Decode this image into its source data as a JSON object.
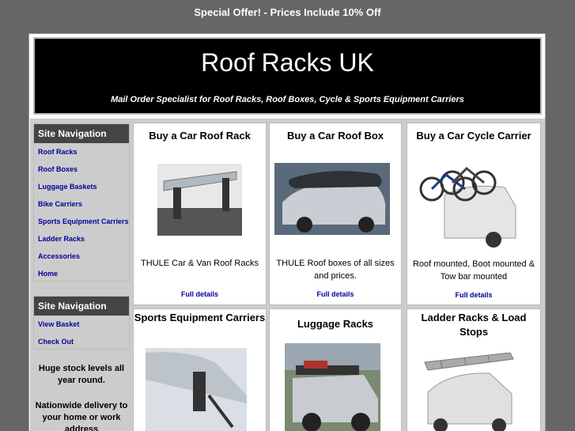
{
  "header": {
    "offer": "Special Offer! - Prices Include 10% Off",
    "title": "Roof Racks UK",
    "subtitle": "Mail Order Specialist for Roof Racks, Roof Boxes, Cycle & Sports Equipment Carriers"
  },
  "nav1": {
    "heading": "Site Navigation",
    "items": [
      "Roof Racks",
      "Roof Boxes",
      "Luggage Baskets",
      "Bike Carriers",
      "Sports Equipment Carriers",
      "Ladder Racks",
      "Accessories",
      "Home"
    ]
  },
  "nav2": {
    "heading": "Site Navigation",
    "items": [
      "View Basket",
      "Check Out"
    ]
  },
  "sidebar": {
    "stock": "Huge stock levels all year round.",
    "delivery": "Nationwide delivery to your home or work address"
  },
  "cards": [
    {
      "title": "Buy a Car Roof Rack",
      "desc": "THULE Car & Van Roof Racks",
      "link": "Full details"
    },
    {
      "title": "Buy a Car Roof Box",
      "desc": "THULE Roof boxes of all sizes and prices.",
      "link": "Full details"
    },
    {
      "title": "Buy a Car Cycle Carrier",
      "desc": "Roof mounted, Boot mounted & Tow bar mounted",
      "link": "Full details"
    },
    {
      "title": "Sports Equipment Carriers"
    },
    {
      "title": "Luggage Racks"
    },
    {
      "title": "Ladder Racks & Load Stops"
    }
  ],
  "colors": {
    "banner": "#000000",
    "nav_heading": "#444444",
    "link": "#000099",
    "page_bg": "#666666"
  }
}
